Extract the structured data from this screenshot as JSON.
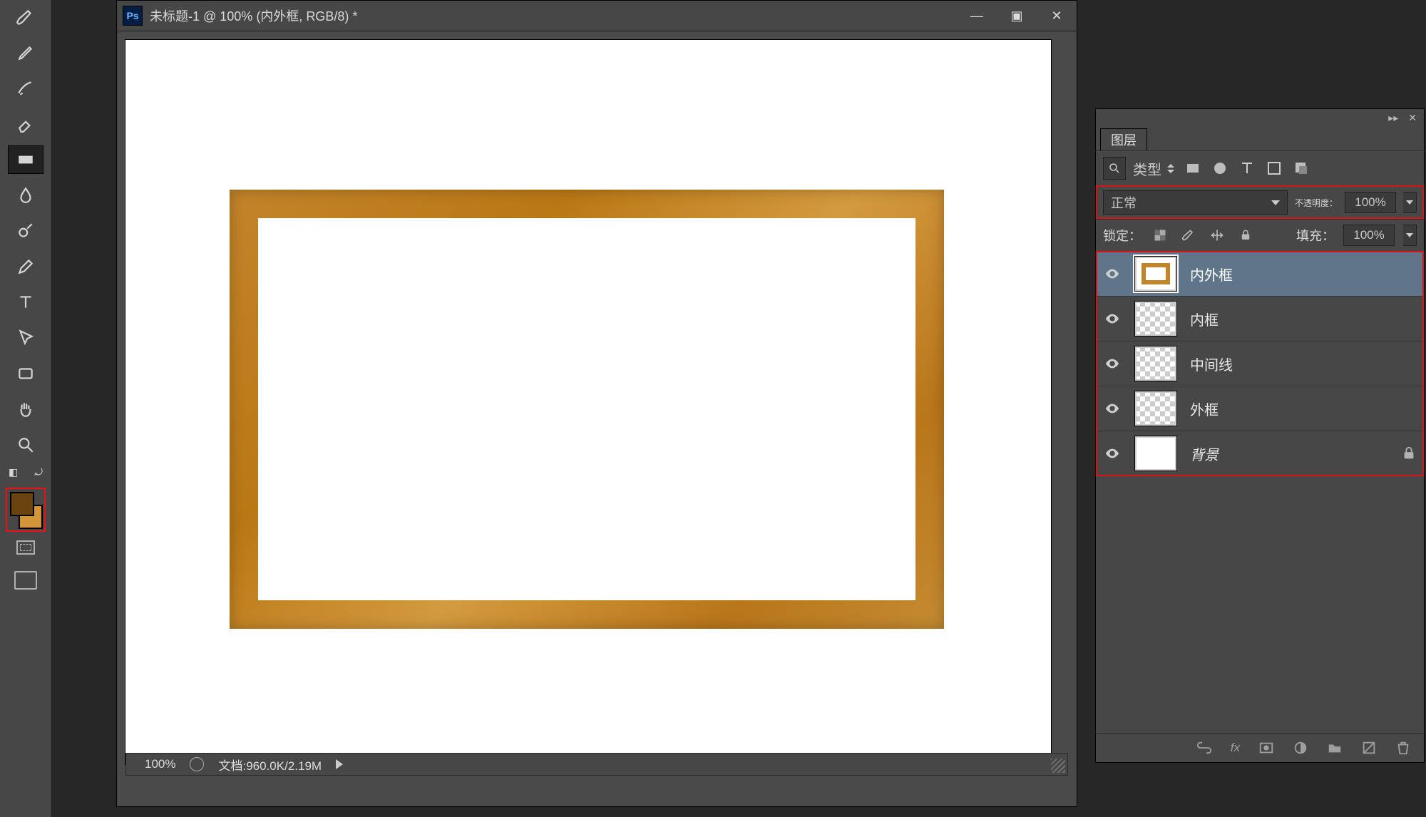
{
  "title": "未标题-1 @ 100% (内外框, RGB/8) *",
  "window_buttons": {
    "min": "—",
    "max": "▣",
    "close": "✕"
  },
  "status": {
    "zoom": "100%",
    "doc": "文档:960.0K/2.19M"
  },
  "fg_color": "#6b430e",
  "bg_color": "#d4943a",
  "layers_panel": {
    "tab": "图层",
    "filter_label": "类型",
    "blend_mode": "正常",
    "opacity_label": "不透明度：",
    "opacity_value": "100%",
    "lock_label": "锁定：",
    "fill_label": "填充：",
    "fill_value": "100%",
    "layers": [
      {
        "name": "内外框",
        "thumb": "frame",
        "selected": true,
        "locked": false
      },
      {
        "name": "内框",
        "thumb": "checker",
        "selected": false,
        "locked": false
      },
      {
        "name": "中间线",
        "thumb": "checker",
        "selected": false,
        "locked": false
      },
      {
        "name": "外框",
        "thumb": "checker",
        "selected": false,
        "locked": false
      },
      {
        "name": "背景",
        "thumb": "white",
        "selected": false,
        "locked": true,
        "italic": true
      }
    ],
    "footer_fx": "fx"
  },
  "tools": [
    "brush",
    "pencil",
    "replace",
    "eraser",
    "gradient",
    "blur",
    "dodge",
    "pen",
    "type",
    "path-select",
    "rectangle",
    "hand",
    "zoom"
  ]
}
